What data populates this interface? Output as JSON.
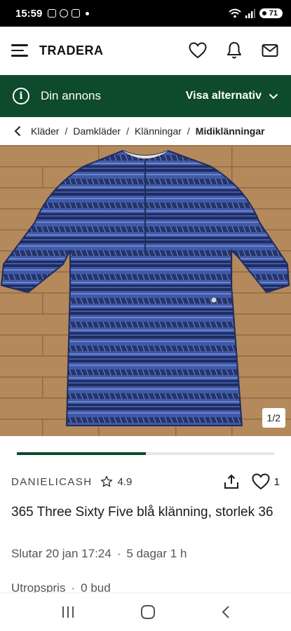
{
  "status_bar": {
    "time": "15:59",
    "battery": "71"
  },
  "app_bar": {
    "logo": "TRADERA"
  },
  "banner": {
    "title": "Din annons",
    "action": "Visa alternativ"
  },
  "breadcrumb": [
    "Kläder",
    "Damkläder",
    "Klänningar",
    "Midiklänningar"
  ],
  "gallery": {
    "counter": "1/2",
    "progress": 0.5
  },
  "seller": {
    "name": "DANIELICASH",
    "rating": "4.9",
    "likes": "1"
  },
  "listing": {
    "title": "365 Three Sixty Five blå klänning, storlek 36",
    "ends": "Slutar 20 jan 17:24",
    "remaining": "5 dagar 1 h",
    "price_label": "Utropspris",
    "bids": "0 bud"
  },
  "colors": {
    "brand_green": "#0e4a2c",
    "dress_blue": "#3f5aa8",
    "floor_wood": "#b48a5c"
  }
}
